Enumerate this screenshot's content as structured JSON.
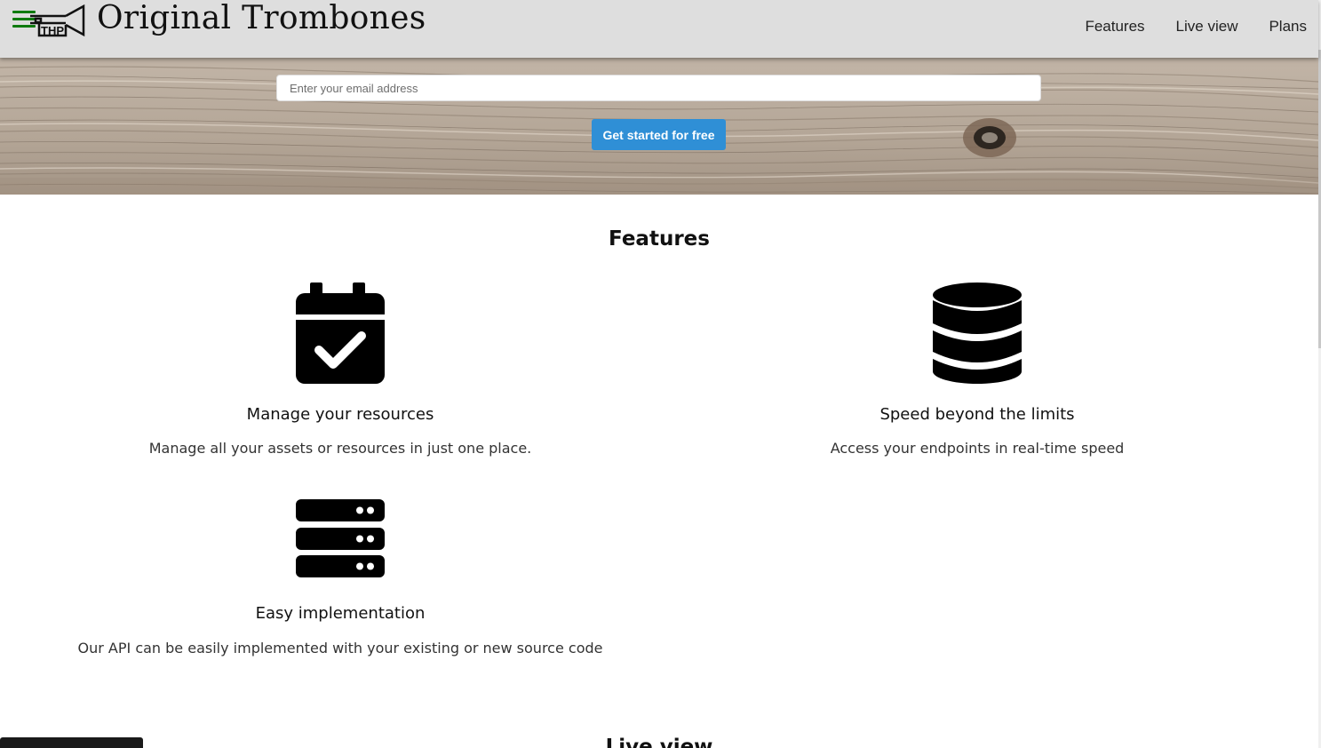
{
  "header": {
    "brand": "Original Trombones",
    "nav": [
      "Features",
      "Live view",
      "Plans"
    ]
  },
  "hero": {
    "email_placeholder": "Enter your email address",
    "cta_label": "Get started for free"
  },
  "features": {
    "title": "Features",
    "items": [
      {
        "icon": "calendar-check-icon",
        "title": "Manage your resources",
        "text": "Manage all your assets or resources in just one place."
      },
      {
        "icon": "database-icon",
        "title": "Speed beyond the limits",
        "text": "Access your endpoints in real-time speed"
      },
      {
        "icon": "server-icon",
        "title": "Easy implementation",
        "text": "Our API can be easily implemented with your existing or new source code"
      }
    ]
  },
  "next_section": {
    "title": "Live view"
  },
  "colors": {
    "header_bg": "#dedede",
    "cta": "#2f8fd6",
    "hamburger": "#0f7a0f"
  }
}
